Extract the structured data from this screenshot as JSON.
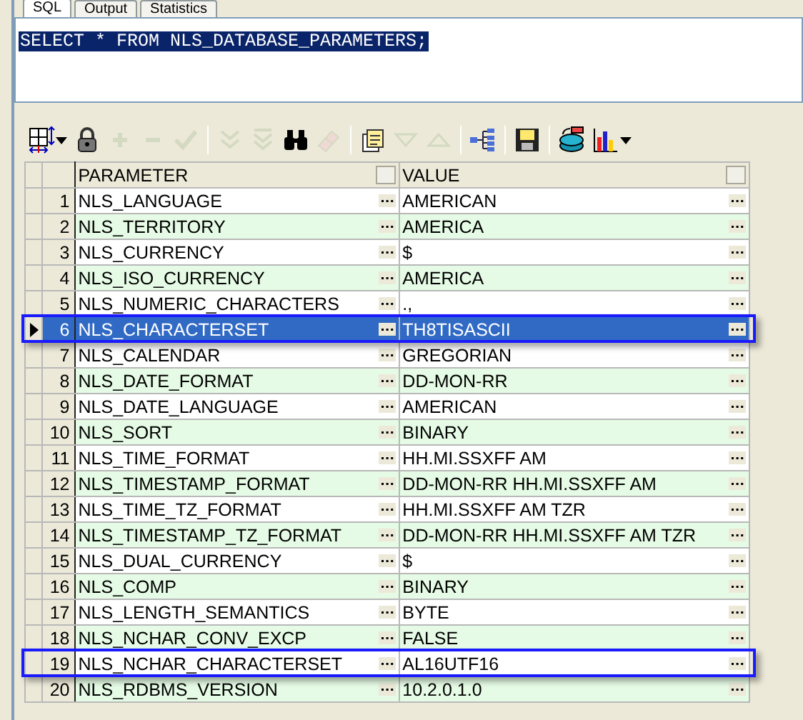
{
  "tabs": [
    {
      "label": "SQL",
      "selected": true
    },
    {
      "label": "Output",
      "selected": false
    },
    {
      "label": "Statistics",
      "selected": false
    }
  ],
  "editor": {
    "text": "SELECT * FROM NLS_DATABASE_PARAMETERS;",
    "selected": true
  },
  "toolbar": [
    {
      "kind": "grid",
      "disabled": false,
      "dropdown": true
    },
    {
      "kind": "lock",
      "disabled": false
    },
    {
      "kind": "plus",
      "disabled": true
    },
    {
      "kind": "minus",
      "disabled": true
    },
    {
      "kind": "check",
      "disabled": true
    },
    {
      "kind": "sep"
    },
    {
      "kind": "down-double",
      "disabled": true
    },
    {
      "kind": "down-double-bar",
      "disabled": true
    },
    {
      "kind": "binoculars",
      "disabled": false
    },
    {
      "kind": "eraser",
      "disabled": true
    },
    {
      "kind": "sep"
    },
    {
      "kind": "documents",
      "disabled": false
    },
    {
      "kind": "tri-down",
      "disabled": true
    },
    {
      "kind": "tri-up",
      "disabled": true
    },
    {
      "kind": "sep"
    },
    {
      "kind": "tree",
      "disabled": false
    },
    {
      "kind": "sep"
    },
    {
      "kind": "save",
      "disabled": false
    },
    {
      "kind": "sep"
    },
    {
      "kind": "database",
      "disabled": false
    },
    {
      "kind": "chart",
      "disabled": false,
      "dropdown": true
    }
  ],
  "table": {
    "columns": [
      "PARAMETER",
      "VALUE"
    ],
    "rows": [
      {
        "num": "1",
        "parameter": "NLS_LANGUAGE",
        "value": "AMERICAN",
        "selected": false,
        "outlined": false
      },
      {
        "num": "2",
        "parameter": "NLS_TERRITORY",
        "value": "AMERICA",
        "selected": false,
        "outlined": false
      },
      {
        "num": "3",
        "parameter": "NLS_CURRENCY",
        "value": "$",
        "selected": false,
        "outlined": false
      },
      {
        "num": "4",
        "parameter": "NLS_ISO_CURRENCY",
        "value": "AMERICA",
        "selected": false,
        "outlined": false
      },
      {
        "num": "5",
        "parameter": "NLS_NUMERIC_CHARACTERS",
        "value": ".,",
        "selected": false,
        "outlined": false
      },
      {
        "num": "6",
        "parameter": "NLS_CHARACTERSET",
        "value": "TH8TISASCII",
        "selected": true,
        "outlined": true
      },
      {
        "num": "7",
        "parameter": "NLS_CALENDAR",
        "value": "GREGORIAN",
        "selected": false,
        "outlined": false
      },
      {
        "num": "8",
        "parameter": "NLS_DATE_FORMAT",
        "value": "DD-MON-RR",
        "selected": false,
        "outlined": false
      },
      {
        "num": "9",
        "parameter": "NLS_DATE_LANGUAGE",
        "value": "AMERICAN",
        "selected": false,
        "outlined": false
      },
      {
        "num": "10",
        "parameter": "NLS_SORT",
        "value": "BINARY",
        "selected": false,
        "outlined": false
      },
      {
        "num": "11",
        "parameter": "NLS_TIME_FORMAT",
        "value": "HH.MI.SSXFF AM",
        "selected": false,
        "outlined": false
      },
      {
        "num": "12",
        "parameter": "NLS_TIMESTAMP_FORMAT",
        "value": "DD-MON-RR HH.MI.SSXFF AM",
        "selected": false,
        "outlined": false
      },
      {
        "num": "13",
        "parameter": "NLS_TIME_TZ_FORMAT",
        "value": "HH.MI.SSXFF AM TZR",
        "selected": false,
        "outlined": false
      },
      {
        "num": "14",
        "parameter": "NLS_TIMESTAMP_TZ_FORMAT",
        "value": "DD-MON-RR HH.MI.SSXFF AM TZR",
        "selected": false,
        "outlined": false
      },
      {
        "num": "15",
        "parameter": "NLS_DUAL_CURRENCY",
        "value": "$",
        "selected": false,
        "outlined": false
      },
      {
        "num": "16",
        "parameter": "NLS_COMP",
        "value": "BINARY",
        "selected": false,
        "outlined": false
      },
      {
        "num": "17",
        "parameter": "NLS_LENGTH_SEMANTICS",
        "value": "BYTE",
        "selected": false,
        "outlined": false
      },
      {
        "num": "18",
        "parameter": "NLS_NCHAR_CONV_EXCP",
        "value": "FALSE",
        "selected": false,
        "outlined": false
      },
      {
        "num": "19",
        "parameter": "NLS_NCHAR_CHARACTERSET",
        "value": "AL16UTF16",
        "selected": false,
        "outlined": true
      },
      {
        "num": "20",
        "parameter": "NLS_RDBMS_VERSION",
        "value": "10.2.0.1.0",
        "selected": false,
        "outlined": false
      }
    ]
  }
}
